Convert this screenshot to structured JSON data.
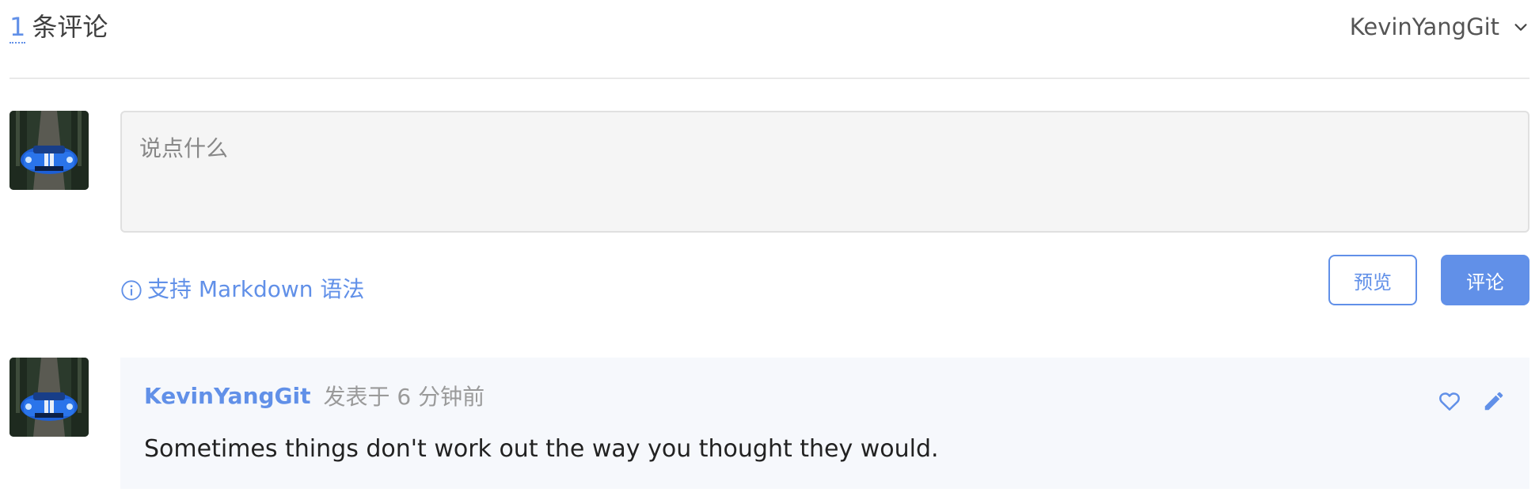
{
  "header": {
    "count": "1",
    "count_label": "条评论",
    "username": "KevinYangGit",
    "chevron_icon": "chevron-down-icon"
  },
  "editor": {
    "placeholder": "说点什么",
    "value": "",
    "markdown_hint": "支持 Markdown 语法",
    "info_icon": "info-circle-icon",
    "preview_label": "预览",
    "submit_label": "评论"
  },
  "comments": [
    {
      "author": "KevinYangGit",
      "time": "发表于 6 分钟前",
      "body": "Sometimes things don't work out the way you thought they would.",
      "like_icon": "heart-icon",
      "edit_icon": "pencil-icon"
    }
  ],
  "colors": {
    "accent": "#6190e8",
    "comment_bg": "#f6f8fc",
    "input_bg": "#f5f5f5",
    "divider": "#e9e9e9"
  }
}
